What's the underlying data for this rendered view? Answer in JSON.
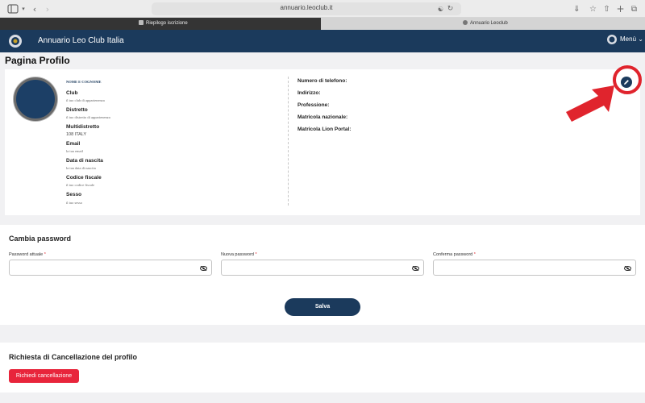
{
  "browser": {
    "url": "annuario.leoclub.it",
    "tabs": [
      {
        "label": "Riepilogo iscrizione",
        "active": true
      },
      {
        "label": "Annuario Leoclub",
        "active": false
      }
    ],
    "icons": [
      "sidebar-icon",
      "chevron-down-icon",
      "back-icon",
      "forward-icon",
      "grid-icon",
      "document-icon",
      "grammarly-icon",
      "translate-icon",
      "reload-icon",
      "download-icon",
      "star-icon",
      "share-icon",
      "plus-icon",
      "tabs-icon"
    ]
  },
  "navbar": {
    "brand": "Annuario Leo Club Italia",
    "menu_label": "Menù",
    "color": "#1b3a5c"
  },
  "page_title": "Pagina Profilo",
  "profile": {
    "name_label": "NOME E COGNOME",
    "fields": [
      {
        "label": "Club",
        "value": "il tuo club di appartenenza"
      },
      {
        "label": "Distretto",
        "value": "il tuo distretto di appartenenza"
      },
      {
        "label": "Multidistretto",
        "value": "108 ITALY"
      },
      {
        "label": "Email",
        "value": "la tua email"
      },
      {
        "label": "Data di nascita",
        "value": "la tua data di nascita"
      },
      {
        "label": "Codice fiscale",
        "value": "il tuo codice fiscale"
      },
      {
        "label": "Sesso",
        "value": "il tuo sesso"
      }
    ],
    "right_fields": [
      "Numero di telefono:",
      "Indirizzo:",
      "Professione:",
      "Matricola nazionale:",
      "Matricola Lion Portal:"
    ]
  },
  "password": {
    "title": "Cambia password",
    "fields": [
      {
        "label": "Password attuale",
        "required": "*"
      },
      {
        "label": "Nuova password",
        "required": "*"
      },
      {
        "label": "Conferma password",
        "required": "*"
      }
    ],
    "save_label": "Salva"
  },
  "delete": {
    "title": "Richiesta di Cancellazione del profilo",
    "button_label": "Richiedi cancellazione",
    "color": "#e8253b"
  },
  "annotation_color": "#e0242d"
}
